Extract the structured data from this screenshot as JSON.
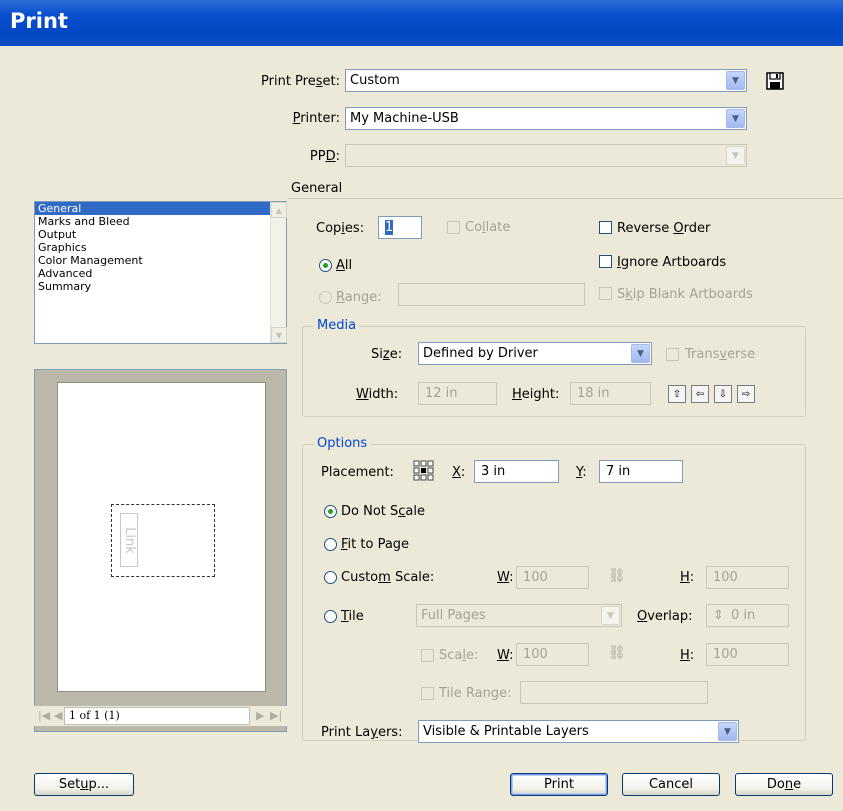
{
  "window": {
    "title": "Print"
  },
  "print_preset": {
    "label_pre": "Print Pre",
    "label_u": "s",
    "label_post": "et:",
    "value": "Custom",
    "save_icon": "floppy-save-icon"
  },
  "printer": {
    "label_u": "P",
    "label_post": "rinter:",
    "value": "My Machine-USB"
  },
  "ppd": {
    "label_pre": "PP",
    "label_u": "D",
    "label_post": ":",
    "value": ""
  },
  "section_heading": "General",
  "sidebar": {
    "items": [
      {
        "label": "General"
      },
      {
        "label": "Marks and Bleed"
      },
      {
        "label": "Output"
      },
      {
        "label": "Graphics"
      },
      {
        "label": "Color Management"
      },
      {
        "label": "Advanced"
      },
      {
        "label": "Summary"
      }
    ]
  },
  "general": {
    "copies_label_pre": "Cop",
    "copies_label_u": "i",
    "copies_label_post": "es:",
    "copies_value": "1",
    "collate_pre": "Co",
    "collate_u": "l",
    "collate_post": "late",
    "reverse_pre": "Reverse ",
    "reverse_u": "O",
    "reverse_post": "rder",
    "all_u": "A",
    "all_post": "ll",
    "ignore_u": "I",
    "ignore_post": "gnore Artboards",
    "range_u": "R",
    "range_post": "ange:",
    "skip_pre": "S",
    "skip_u": "k",
    "skip_post": "ip Blank Artboards"
  },
  "media": {
    "title": "Media",
    "size_label_pre": "Si",
    "size_label_u": "z",
    "size_label_post": "e:",
    "size_value": "Defined by Driver",
    "transverse_pre": "Trans",
    "transverse_u": "v",
    "transverse_post": "erse",
    "width_u": "W",
    "width_post": "idth:",
    "width_value": "12 in",
    "height_u": "H",
    "height_post": "eight:",
    "height_value": "18 in"
  },
  "options": {
    "title": "Options",
    "placement_label": "Placement:",
    "x_label_u": "X",
    "x_label_post": ":",
    "x_value": "3 in",
    "y_label_u": "Y",
    "y_label_post": ":",
    "y_value": "7 in",
    "do_not_scale_pre": "Do Not S",
    "do_not_scale_u": "c",
    "do_not_scale_post": "ale",
    "fit_u": "F",
    "fit_post": "it to Page",
    "custom_pre": "Custo",
    "custom_u": "m",
    "custom_post": " Scale:",
    "cw_u": "W",
    "cw_post": ":",
    "cw_value": "100",
    "ch_u": "H",
    "ch_post": ":",
    "ch_value": "100",
    "tile_u": "T",
    "tile_post": "ile",
    "tile_mode": "Full Pages",
    "overlap_u": "O",
    "overlap_post": "verlap:",
    "overlap_value": "0 in",
    "scale_pre": "Sca",
    "scale_u": "l",
    "scale_post": "e:",
    "sw_u": "W",
    "sw_post": ":",
    "sw_value": "100",
    "sh_u": "H",
    "sh_post": ":",
    "sh_value": "100",
    "tile_range_label": "Tile Range:",
    "print_layers_pre": "Print La",
    "print_layers_u": "y",
    "print_layers_post": "ers:",
    "print_layers_value": "Visible & Printable Layers"
  },
  "preview": {
    "link_text": "Link",
    "page_indicator": "1 of 1 (1)"
  },
  "buttons": {
    "setup_pre": "Set",
    "setup_u": "u",
    "setup_post": "p...",
    "print": "Print",
    "cancel": "Cancel",
    "done_pre": "Do",
    "done_u": "n",
    "done_post": "e"
  }
}
